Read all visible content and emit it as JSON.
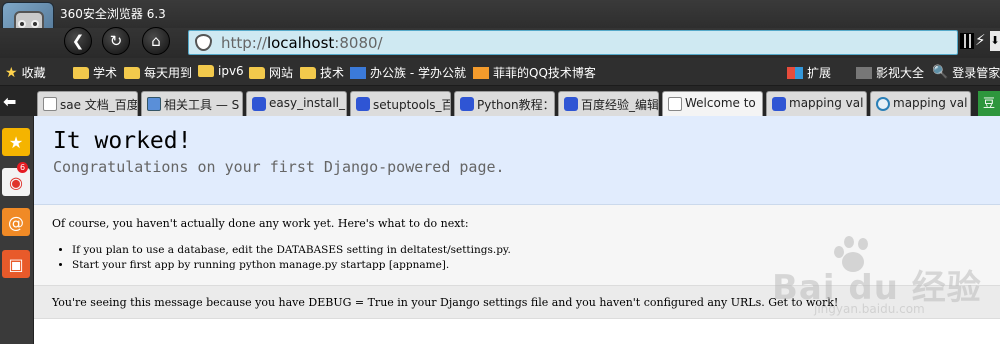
{
  "window": {
    "title": "360安全浏览器 6.3"
  },
  "address_bar": {
    "url_prefix": "http://",
    "url_host": "localhost",
    "url_rest": ":8080/"
  },
  "bookmarks": [
    {
      "label": "收藏",
      "icon": "star-icon"
    },
    {
      "label": "学术",
      "icon": "folder-icon"
    },
    {
      "label": "每天用到",
      "icon": "folder-icon"
    },
    {
      "label": "ipv6",
      "icon": "folder-icon"
    },
    {
      "label": "网站",
      "icon": "folder-icon"
    },
    {
      "label": "技术",
      "icon": "folder-icon"
    },
    {
      "label": "办公族 - 学办公就",
      "icon": "bangong-icon"
    },
    {
      "label": "菲菲的QQ技术博客",
      "icon": "blog-icon"
    },
    {
      "label": "扩展",
      "icon": "grid-icon"
    },
    {
      "label": "影视大全",
      "icon": "play-icon"
    },
    {
      "label": "登录管家",
      "icon": "search-icon"
    }
  ],
  "tabs": [
    {
      "label": "sae 文档_百度",
      "icon": "doc-icon"
    },
    {
      "label": "相关工具 — S",
      "icon": "image-icon"
    },
    {
      "label": "easy_install_",
      "icon": "baidu-paw-icon"
    },
    {
      "label": "setuptools_百",
      "icon": "baidu-paw-icon"
    },
    {
      "label": "Python教程：",
      "icon": "baidu-paw-icon"
    },
    {
      "label": "百度经验_编辑",
      "icon": "baidu-paw-icon"
    },
    {
      "label": "Welcome to",
      "icon": "doc-icon"
    },
    {
      "label": "mapping val",
      "icon": "baidu-paw-icon"
    },
    {
      "label": "mapping val",
      "icon": "g-icon"
    },
    {
      "label": "豆",
      "icon": "douban-icon"
    }
  ],
  "sidebar": {
    "weibo_badge": "6"
  },
  "page": {
    "title": "It worked!",
    "subtitle": "Congratulations on your first Django-powered page.",
    "intro": "Of course, you haven't actually done any work yet. Here's what to do next:",
    "steps": [
      "If you plan to use a database, edit the DATABASES setting in deltatest/settings.py.",
      "Start your first app by running python manage.py startapp [appname]."
    ],
    "explanation": "You're seeing this message because you have DEBUG = True in your Django settings file and you haven't configured any URLs. Get to work!"
  },
  "watermark": {
    "brand": "Bai du 经验",
    "url": "jingyan.baidu.com"
  },
  "colors": {
    "url_border": "#55a9c9",
    "summary_bg": "#e1ecfd",
    "explanation_bg": "#ebebeb"
  }
}
